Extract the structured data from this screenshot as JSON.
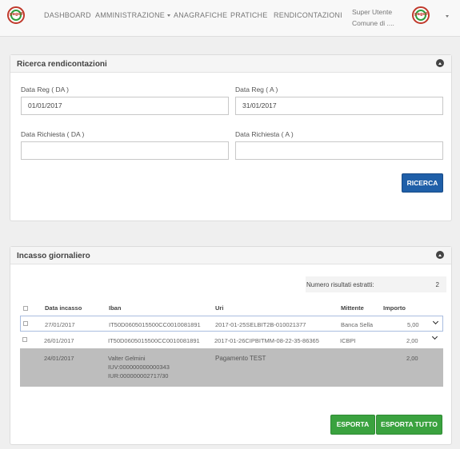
{
  "navbar": {
    "logo_text": "pagoPA",
    "items": [
      {
        "label": "DASHBOARD"
      },
      {
        "label": "AMMINISTRAZIONE"
      },
      {
        "label": "ANAGRAFICHE"
      },
      {
        "label": "PRATICHE"
      },
      {
        "label": "RENDICONTAZIONI"
      }
    ],
    "user_name": "Super Utente",
    "user_entity": "Comune di ...."
  },
  "search_panel": {
    "title": "Ricerca rendicontazioni",
    "data_reg_da_label": "Data Reg ( DA )",
    "data_reg_da_value": "01/01/2017",
    "data_reg_a_label": "Data Reg ( A )",
    "data_reg_a_value": "31/01/2017",
    "data_richiesta_da_label": "Data Richiesta ( DA )",
    "data_richiesta_da_value": "",
    "data_richiesta_a_label": "Data Richiesta ( A )",
    "data_richiesta_a_value": "",
    "search_button": "RICERCA"
  },
  "income_panel": {
    "title": "Incasso giornaliero",
    "results_label": "Numero risultati estratti:",
    "results_count": "2",
    "columns": {
      "data_incasso": "Data incasso",
      "iban": "Iban",
      "uri": "Uri",
      "mittente": "Mittente",
      "importo": "Importo"
    },
    "rows": [
      {
        "data_incasso": "27/01/2017",
        "iban": "IT50D0605015500CC0010081891",
        "uri": "2017-01-25SELBIT2B-010021377",
        "mittente": "Banca Sella",
        "importo": "5,00"
      },
      {
        "data_incasso": "26/01/2017",
        "iban": "IT50D0605015500CC0010081891",
        "uri": "2017-01-26CIPBITMM-08-22-35-86365",
        "mittente": "ICBPI",
        "importo": "2,00"
      }
    ],
    "detail": {
      "data": "24/01/2017",
      "name": "Valter Gelmini",
      "iuv": "IUV:000000000000343",
      "iur": "IUR:000000002717/30",
      "description": "Pagamento TEST",
      "importo": "2,00"
    },
    "export_button": "ESPORTA",
    "export_all_button": "ESPORTA TUTTO"
  },
  "colors": {
    "primary_blue": "#1f5fa8",
    "export_green": "#3aa23f",
    "detail_gray": "#bdbdbd"
  },
  "icons": [
    "collapse-icon",
    "caret-down-icon",
    "chevron-down-icon",
    "checkbox-icon"
  ]
}
